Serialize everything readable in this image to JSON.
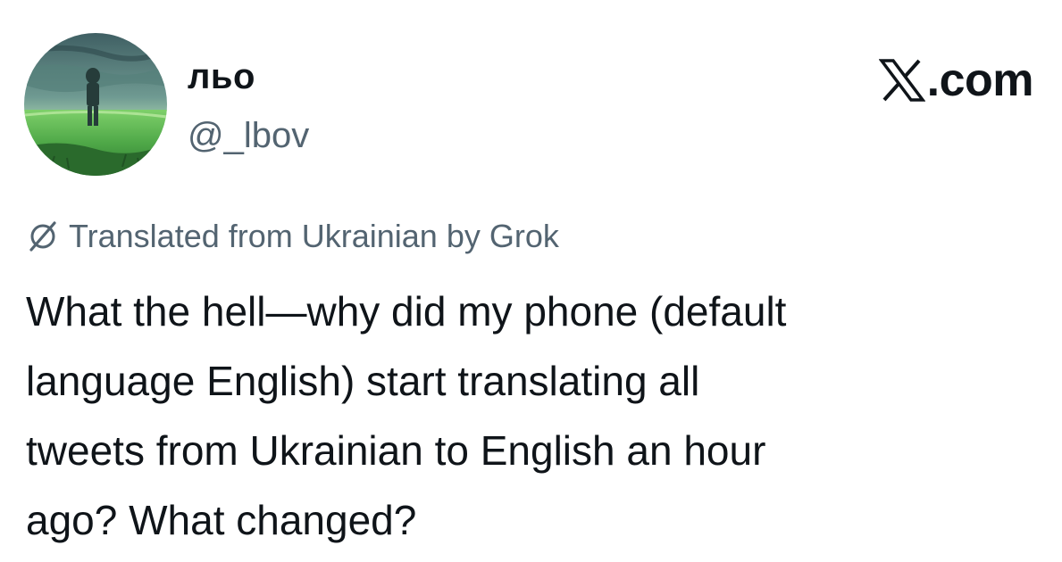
{
  "author": {
    "display_name": "льо",
    "handle": "@_lbov"
  },
  "brand": {
    "text": ".com",
    "logo_icon": "x-logo-icon"
  },
  "translation": {
    "label": "Translated from Ukrainian by Grok",
    "icon": "grok-icon"
  },
  "tweet": {
    "text": "What the hell—why did my phone (default\nlanguage English) start translating all\ntweets from Ukrainian to English an hour\nago? What changed?"
  },
  "colors": {
    "text_primary": "#0f1419",
    "text_secondary": "#536471",
    "background": "#ffffff"
  }
}
